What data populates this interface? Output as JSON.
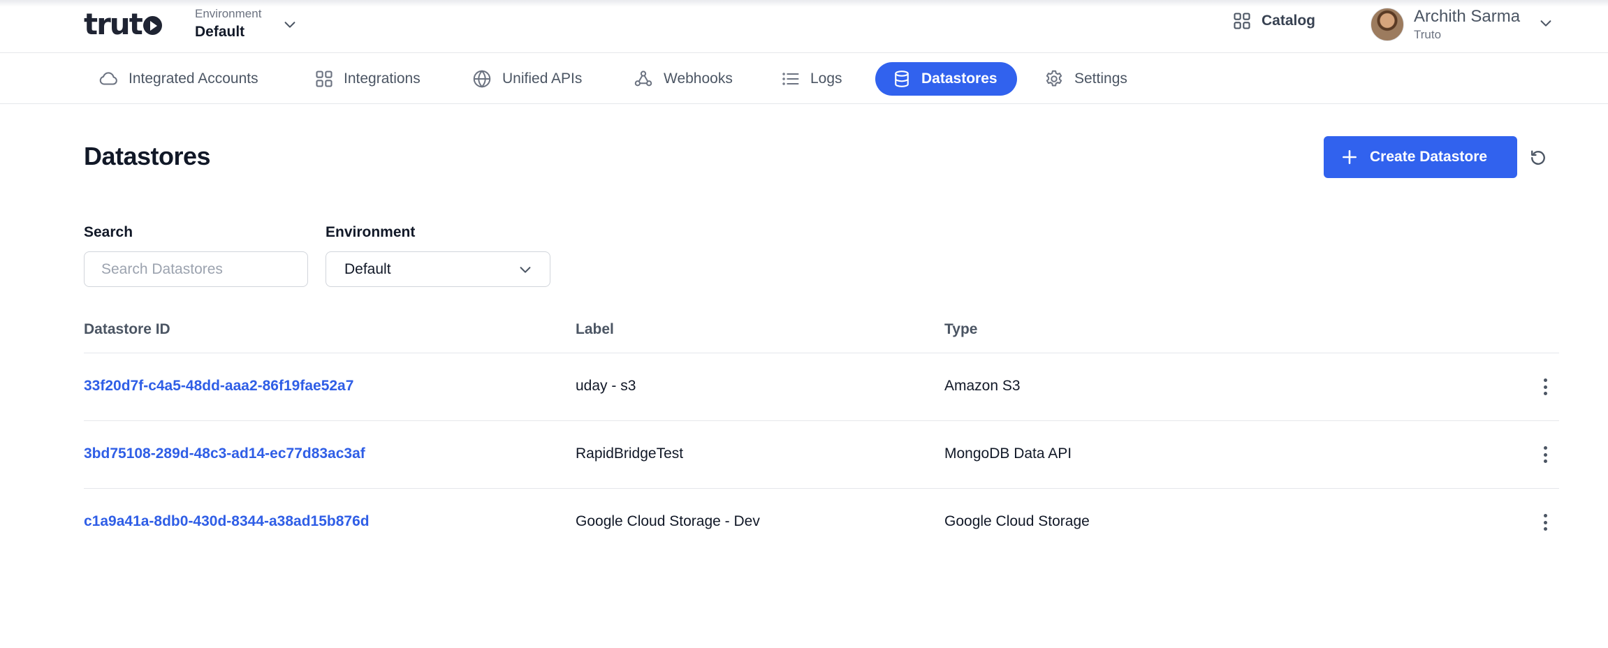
{
  "header": {
    "logo_text": "truto",
    "environment_label": "Environment",
    "environment_value": "Default",
    "catalog_label": "Catalog",
    "user_name": "Archith Sarma",
    "user_org": "Truto"
  },
  "nav": {
    "items": [
      {
        "label": "Integrated Accounts",
        "icon": "cloud-icon"
      },
      {
        "label": "Integrations",
        "icon": "grid-icon"
      },
      {
        "label": "Unified APIs",
        "icon": "globe-icon"
      },
      {
        "label": "Webhooks",
        "icon": "webhook-icon"
      },
      {
        "label": "Logs",
        "icon": "list-icon"
      },
      {
        "label": "Datastores",
        "icon": "database-icon",
        "active": true
      },
      {
        "label": "Settings",
        "icon": "gear-icon"
      }
    ]
  },
  "page": {
    "title": "Datastores",
    "create_button_label": "Create Datastore"
  },
  "filters": {
    "search_label": "Search",
    "search_placeholder": "Search Datastores",
    "search_value": "",
    "environment_label": "Environment",
    "environment_value": "Default"
  },
  "table": {
    "columns": [
      "Datastore ID",
      "Label",
      "Type"
    ],
    "rows": [
      {
        "id": "33f20d7f-c4a5-48dd-aaa2-86f19fae52a7",
        "label": "uday - s3",
        "type": "Amazon S3"
      },
      {
        "id": "3bd75108-289d-48c3-ad14-ec77d83ac3af",
        "label": "RapidBridgeTest",
        "type": "MongoDB Data API"
      },
      {
        "id": "c1a9a41a-8db0-430d-8344-a38ad15b876d",
        "label": "Google Cloud Storage - Dev",
        "type": "Google Cloud Storage"
      }
    ]
  },
  "colors": {
    "accent": "#3162ee",
    "link": "#2f5ee6",
    "border": "#e5e7eb"
  }
}
